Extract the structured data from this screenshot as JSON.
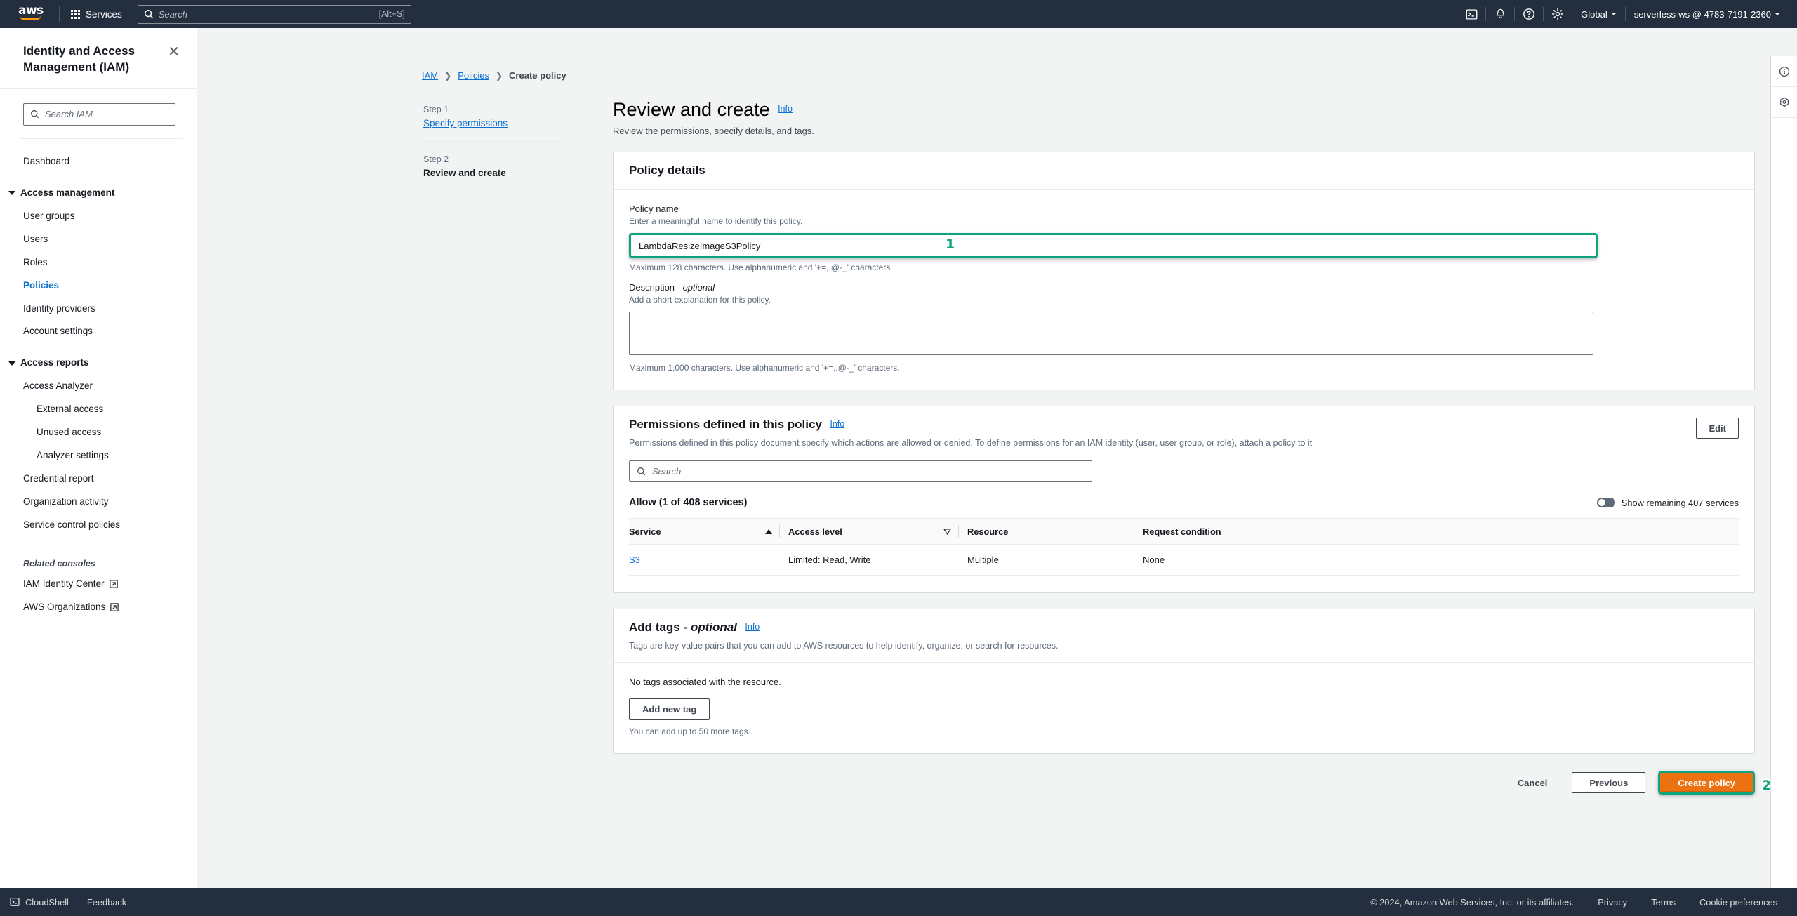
{
  "topnav": {
    "logo_alt": "aws",
    "services_label": "Services",
    "search_placeholder": "Search",
    "search_shortcut": "[Alt+S]",
    "cloudshell_icon": "cloudshell-icon",
    "bell_icon": "notifications-icon",
    "help_icon": "help-icon",
    "settings_icon": "settings-icon",
    "region_label": "Global",
    "account_label": "serverless-ws @ 4783-7191-2360"
  },
  "sidebar": {
    "title": "Identity and Access Management (IAM)",
    "close_icon": "close-icon",
    "search_placeholder": "Search IAM",
    "items": [
      {
        "label": "Dashboard",
        "level": "sub",
        "active": false
      },
      {
        "label": "Access management",
        "level": "group",
        "active": false
      },
      {
        "label": "User groups",
        "level": "sub",
        "active": false
      },
      {
        "label": "Users",
        "level": "sub",
        "active": false
      },
      {
        "label": "Roles",
        "level": "sub",
        "active": false
      },
      {
        "label": "Policies",
        "level": "sub",
        "active": true
      },
      {
        "label": "Identity providers",
        "level": "sub",
        "active": false
      },
      {
        "label": "Account settings",
        "level": "sub",
        "active": false
      },
      {
        "label": "Access reports",
        "level": "group",
        "active": false
      },
      {
        "label": "Access Analyzer",
        "level": "sub",
        "active": false
      },
      {
        "label": "External access",
        "level": "sub2",
        "active": false
      },
      {
        "label": "Unused access",
        "level": "sub2",
        "active": false
      },
      {
        "label": "Analyzer settings",
        "level": "sub2",
        "active": false
      },
      {
        "label": "Credential report",
        "level": "sub",
        "active": false
      },
      {
        "label": "Organization activity",
        "level": "sub",
        "active": false
      },
      {
        "label": "Service control policies",
        "level": "sub",
        "active": false
      }
    ],
    "related_heading": "Related consoles",
    "related": [
      {
        "label": "IAM Identity Center"
      },
      {
        "label": "AWS Organizations"
      }
    ]
  },
  "breadcrumb": {
    "items": [
      "IAM",
      "Policies",
      "Create policy"
    ]
  },
  "steps": [
    {
      "num": "Step 1",
      "label": "Specify permissions",
      "current": false
    },
    {
      "num": "Step 2",
      "label": "Review and create",
      "current": true
    }
  ],
  "page": {
    "title": "Review and create",
    "info": "Info",
    "subtitle": "Review the permissions, specify details, and tags."
  },
  "policy_details": {
    "heading": "Policy details",
    "name_label": "Policy name",
    "name_hint": "Enter a meaningful name to identify this policy.",
    "name_value": "LambdaResizeImageS3Policy",
    "name_foot": "Maximum 128 characters. Use alphanumeric and '+=,.@-_' characters.",
    "desc_label": "Description - ",
    "desc_label_optional": "optional",
    "desc_hint": "Add a short explanation for this policy.",
    "desc_value": "",
    "desc_foot": "Maximum 1,000 characters. Use alphanumeric and '+=,.@-_' characters."
  },
  "permissions": {
    "heading": "Permissions defined in this policy",
    "info": "Info",
    "description": "Permissions defined in this policy document specify which actions are allowed or denied. To define permissions for an IAM identity (user, user group, or role), attach a policy to it",
    "edit_label": "Edit",
    "search_placeholder": "Search",
    "allow_title": "Allow (1 of 408 services)",
    "toggle_label": "Show remaining 407 services",
    "toggle_on": false,
    "columns": [
      "Service",
      "Access level",
      "Resource",
      "Request condition"
    ],
    "rows": [
      {
        "service": "S3",
        "access_level": "Limited: Read, Write",
        "resource": "Multiple",
        "request_condition": "None"
      }
    ]
  },
  "tags": {
    "heading": "Add tags - ",
    "heading_optional": "optional",
    "info": "Info",
    "description": "Tags are key-value pairs that you can add to AWS resources to help identify, organize, or search for resources.",
    "empty_text": "No tags associated with the resource.",
    "add_button": "Add new tag",
    "foot_text": "You can add up to 50 more tags."
  },
  "actions": {
    "cancel": "Cancel",
    "previous": "Previous",
    "create": "Create policy"
  },
  "markers": {
    "one": "1",
    "two": "2"
  },
  "rail": {
    "info_icon": "info-circle-icon",
    "settings_icon": "gear-hex-icon"
  },
  "footer": {
    "cloudshell": "CloudShell",
    "feedback": "Feedback",
    "copyright": "© 2024, Amazon Web Services, Inc. or its affiliates.",
    "links": [
      "Privacy",
      "Terms",
      "Cookie preferences"
    ]
  },
  "colors": {
    "nav_bg": "#232f3e",
    "link": "#0972d3",
    "primary_button": "#ec7211",
    "highlight_ring": "#10a37f",
    "page_bg": "#f2f3f3"
  }
}
